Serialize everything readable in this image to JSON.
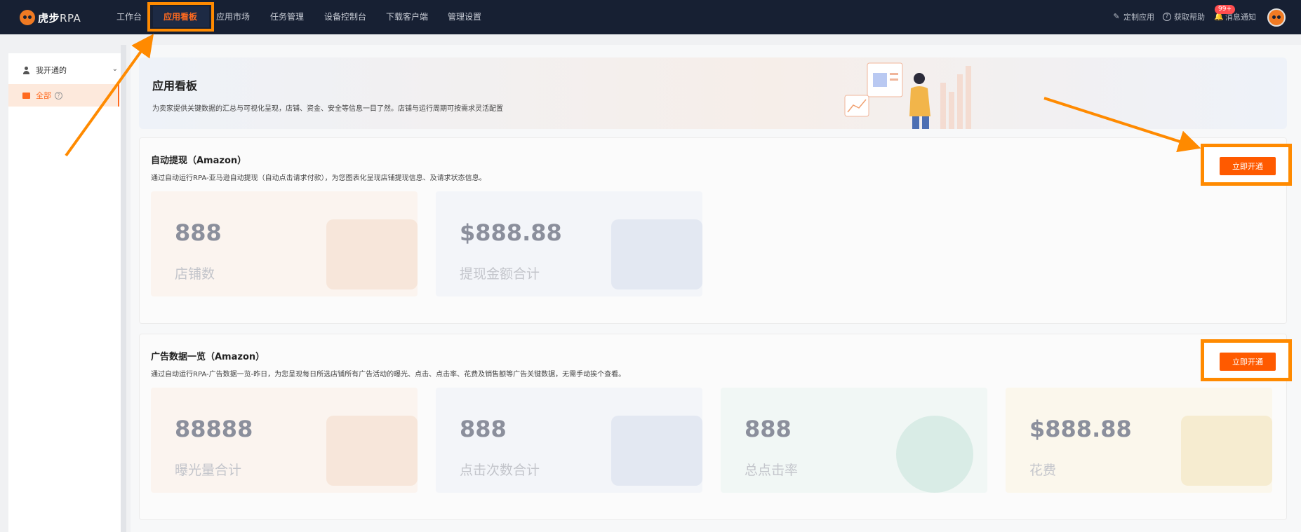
{
  "header": {
    "logo_text": "虎步",
    "logo_suffix": "RPA",
    "nav": [
      {
        "label": "工作台"
      },
      {
        "label": "应用看板"
      },
      {
        "label": "应用市场"
      },
      {
        "label": "任务管理"
      },
      {
        "label": "设备控制台"
      },
      {
        "label": "下载客户端"
      },
      {
        "label": "管理设置"
      }
    ],
    "active_nav": "应用看板",
    "tools": {
      "custom_app": "定制应用",
      "get_help": "获取帮助",
      "notifications": "消息通知",
      "notification_badge": "99+"
    }
  },
  "sidebar": {
    "group_label": "我开通的",
    "items": [
      {
        "label": "全部"
      }
    ]
  },
  "banner": {
    "title": "应用看板",
    "description": "为卖家提供关键数据的汇总与可视化呈现，店铺、资金、安全等信息一目了然。店铺与运行周期可按需求灵活配置"
  },
  "cards": [
    {
      "title": "自动提现（Amazon）",
      "description": "通过自动运行RPA-亚马逊自动提现（自动点击请求付款），为您图表化呈现店铺提现信息、及请求状态信息。",
      "button_label": "立即开通",
      "stats": [
        {
          "value": "888",
          "label": "店铺数"
        },
        {
          "value": "$888.88",
          "label": "提现金额合计"
        }
      ]
    },
    {
      "title": "广告数据一览（Amazon）",
      "description": "通过自动运行RPA-广告数据一览-昨日，为您呈现每日所选店铺所有广告活动的曝光、点击、点击率、花费及销售额等广告关键数据，无需手动挨个查看。",
      "button_label": "立即开通",
      "stats": [
        {
          "value": "88888",
          "label": "曝光量合计"
        },
        {
          "value": "888",
          "label": "点击次数合计"
        },
        {
          "value": "888",
          "label": "总点击率"
        },
        {
          "value": "$888.88",
          "label": "花费"
        }
      ]
    }
  ],
  "colors": {
    "nav_bg": "#172033",
    "accent": "#ff5a00",
    "highlight": "#ff8a00"
  }
}
